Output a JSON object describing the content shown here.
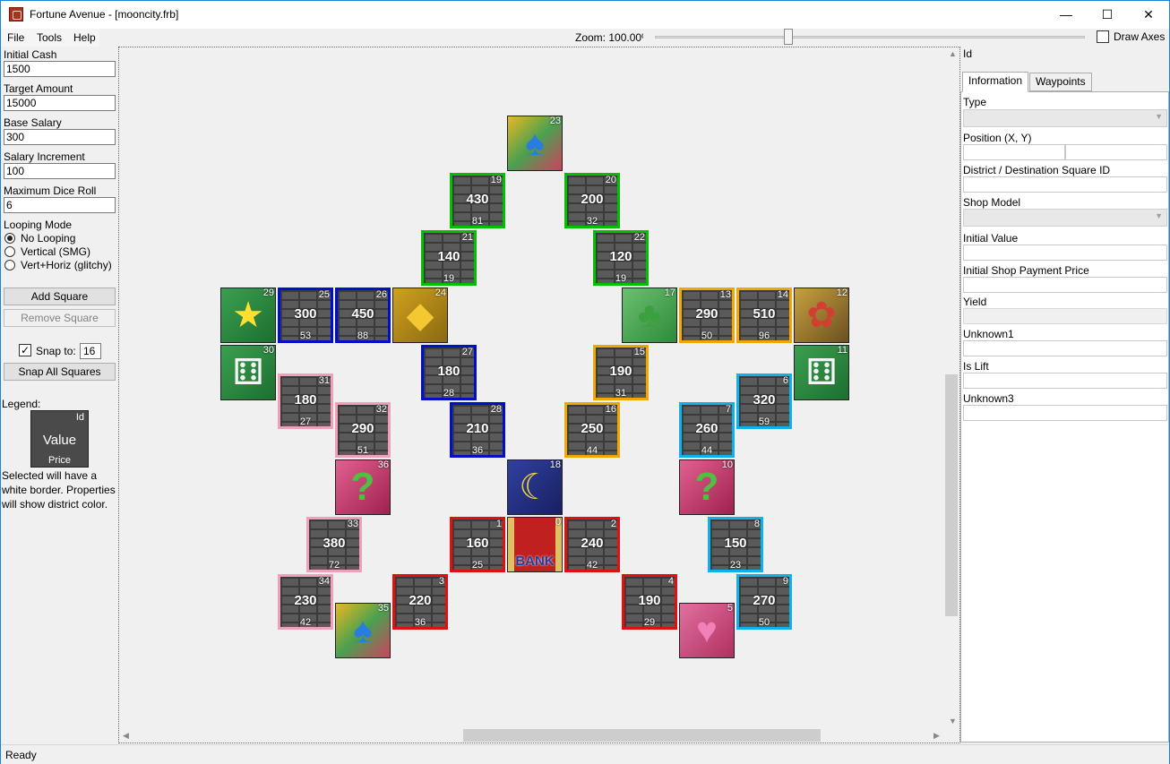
{
  "window": {
    "title": "Fortune Avenue - [mooncity.frb]",
    "minimize": "—",
    "maximize": "☐",
    "close": "✕"
  },
  "menu": {
    "file": "File",
    "tools": "Tools",
    "help": "Help"
  },
  "toolbar": {
    "zoom_label": "Zoom: 100.00%",
    "draw_axes": "Draw Axes",
    "draw_axes_checked": false
  },
  "left_panel": {
    "initial_cash_label": "Initial Cash",
    "initial_cash": "1500",
    "target_amount_label": "Target Amount",
    "target_amount": "15000",
    "base_salary_label": "Base Salary",
    "base_salary": "300",
    "salary_increment_label": "Salary Increment",
    "salary_increment": "100",
    "max_dice_label": "Maximum Dice Roll",
    "max_dice": "6",
    "looping_label": "Looping Mode",
    "looping_options": [
      "No Looping",
      "Vertical (SMG)",
      "Vert+Horiz (glitchy)"
    ],
    "looping_selected": "No Looping",
    "add_square": "Add Square",
    "remove_square": "Remove Square",
    "snap_label": "Snap to:",
    "snap_value": "16",
    "snap_checked": true,
    "snap_all": "Snap All Squares",
    "legend_label": "Legend:",
    "legend_tile": {
      "id": "Id",
      "value": "Value",
      "price": "Price"
    },
    "legend_note": "Selected will have a white border. Properties will show district color."
  },
  "board": {
    "district_colors": {
      "green": "#00c000",
      "blue": "#0010c8",
      "orange": "#f0a800",
      "pink": "#f0a0b8",
      "cyan": "#10b0e8",
      "red": "#e01010"
    },
    "squares": [
      {
        "id": "23",
        "kind": "spade"
      },
      {
        "id": "19",
        "kind": "property",
        "district": "green",
        "value": "430",
        "price": "81"
      },
      {
        "id": "20",
        "kind": "property",
        "district": "green",
        "value": "200",
        "price": "32"
      },
      {
        "id": "21",
        "kind": "property",
        "district": "green",
        "value": "140",
        "price": "19"
      },
      {
        "id": "22",
        "kind": "property",
        "district": "green",
        "value": "120",
        "price": "19"
      },
      {
        "id": "29",
        "kind": "star"
      },
      {
        "id": "25",
        "kind": "property",
        "district": "blue",
        "value": "300",
        "price": "53"
      },
      {
        "id": "26",
        "kind": "property",
        "district": "blue",
        "value": "450",
        "price": "88"
      },
      {
        "id": "24",
        "kind": "switch"
      },
      {
        "id": "17",
        "kind": "club"
      },
      {
        "id": "13",
        "kind": "property",
        "district": "orange",
        "value": "290",
        "price": "50"
      },
      {
        "id": "14",
        "kind": "property",
        "district": "orange",
        "value": "510",
        "price": "96"
      },
      {
        "id": "12",
        "kind": "vacant"
      },
      {
        "id": "30",
        "kind": "dice"
      },
      {
        "id": "27",
        "kind": "property",
        "district": "blue",
        "value": "180",
        "price": "28"
      },
      {
        "id": "15",
        "kind": "property",
        "district": "orange",
        "value": "190",
        "price": "31"
      },
      {
        "id": "11",
        "kind": "dice"
      },
      {
        "id": "31",
        "kind": "property",
        "district": "pink",
        "value": "180",
        "price": "27"
      },
      {
        "id": "6",
        "kind": "property",
        "district": "cyan",
        "value": "320",
        "price": "59"
      },
      {
        "id": "32",
        "kind": "property",
        "district": "pink",
        "value": "290",
        "price": "51"
      },
      {
        "id": "28",
        "kind": "property",
        "district": "blue",
        "value": "210",
        "price": "36"
      },
      {
        "id": "16",
        "kind": "property",
        "district": "orange",
        "value": "250",
        "price": "44"
      },
      {
        "id": "7",
        "kind": "property",
        "district": "cyan",
        "value": "260",
        "price": "44"
      },
      {
        "id": "36",
        "kind": "venture"
      },
      {
        "id": "18",
        "kind": "moon"
      },
      {
        "id": "10",
        "kind": "venture"
      },
      {
        "id": "33",
        "kind": "property",
        "district": "pink",
        "value": "380",
        "price": "72"
      },
      {
        "id": "1",
        "kind": "property",
        "district": "red",
        "value": "160",
        "price": "25"
      },
      {
        "id": "0",
        "kind": "bank",
        "label": "BANK"
      },
      {
        "id": "2",
        "kind": "property",
        "district": "red",
        "value": "240",
        "price": "42"
      },
      {
        "id": "8",
        "kind": "property",
        "district": "cyan",
        "value": "150",
        "price": "23"
      },
      {
        "id": "34",
        "kind": "property",
        "district": "pink",
        "value": "230",
        "price": "42"
      },
      {
        "id": "3",
        "kind": "property",
        "district": "red",
        "value": "220",
        "price": "36"
      },
      {
        "id": "4",
        "kind": "property",
        "district": "red",
        "value": "190",
        "price": "29"
      },
      {
        "id": "9",
        "kind": "property",
        "district": "cyan",
        "value": "270",
        "price": "50"
      },
      {
        "id": "35",
        "kind": "spade"
      },
      {
        "id": "5",
        "kind": "heart"
      }
    ]
  },
  "right_panel": {
    "id_label": "Id",
    "tabs": [
      "Information",
      "Waypoints"
    ],
    "active_tab": "Information",
    "type_label": "Type",
    "position_label": "Position (X, Y)",
    "district_label": "District / Destination Square ID",
    "shop_model_label": "Shop Model",
    "initial_value_label": "Initial Value",
    "initial_payment_label": "Initial Shop Payment Price",
    "yield_label": "Yield",
    "unknown1_label": "Unknown1",
    "is_lift_label": "Is Lift",
    "unknown3_label": "Unknown3"
  },
  "status": {
    "text": "Ready"
  }
}
